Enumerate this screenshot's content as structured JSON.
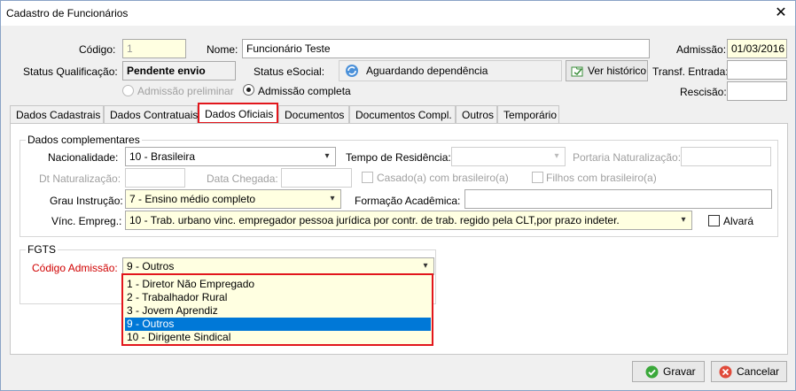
{
  "window": {
    "title": "Cadastro de Funcionários",
    "close_glyph": "✕"
  },
  "header": {
    "codigo_label": "Código:",
    "codigo_value": "1",
    "nome_label": "Nome:",
    "nome_value": "Funcionário Teste",
    "admissao_label": "Admissão:",
    "admissao_value": "01/03/2016",
    "status_qual_label": "Status Qualificação:",
    "status_qual_value": "Pendente envio",
    "status_esocial_label": "Status eSocial:",
    "status_esocial_value": "Aguardando dependência",
    "ver_historico_label": "Ver histórico",
    "transf_label": "Transf. Entrada:",
    "transf_value": "",
    "rescisao_label": "Rescisão:",
    "rescisao_value": "",
    "radio_preliminar": "Admissão preliminar",
    "radio_completa": "Admissão completa"
  },
  "tabs": [
    "Dados Cadastrais",
    "Dados Contratuais",
    "Dados Oficiais",
    "Documentos",
    "Documentos Compl.",
    "Outros",
    "Temporário"
  ],
  "dados_complementares": {
    "group_title": "Dados complementares",
    "nacionalidade_label": "Nacionalidade:",
    "nacionalidade_value": "10  -  Brasileira",
    "tempo_residencia_label": "Tempo de Residência:",
    "tempo_residencia_value": "",
    "portaria_label": "Portaria Naturalização:",
    "portaria_value": "",
    "dt_naturalizacao_label": "Dt Naturalização:",
    "dt_naturalizacao_value": "",
    "data_chegada_label": "Data Chegada:",
    "data_chegada_value": "",
    "casado_label": "Casado(a) com brasileiro(a)",
    "filhos_label": "Filhos com brasileiro(a)",
    "grau_instrucao_label": "Grau Instrução:",
    "grau_instrucao_value": "7  -  Ensino médio completo",
    "formacao_label": "Formação Acadêmica:",
    "formacao_value": "",
    "vinc_label": "Vínc. Empreg.:",
    "vinc_value": "10  -  Trab. urbano vinc.  empregador pessoa jurídica por contr. de trab. regido pela CLT,por prazo indeter.",
    "alvara_label": "Alvará"
  },
  "fgts": {
    "group_title": "FGTS",
    "codigo_admissao_label": "Código Admissão:",
    "codigo_admissao_value": "9 - Outros",
    "options": [
      "1 - Diretor Não Empregado",
      "2 - Trabalhador Rural",
      "3 - Jovem Aprendiz",
      "9 - Outros",
      "10 - Dirigente Sindical"
    ],
    "selected_index": 3
  },
  "footer": {
    "gravar_label": "Gravar",
    "cancelar_label": "Cancelar"
  },
  "colors": {
    "highlight_red": "#e2161c",
    "selection_blue": "#0078d7",
    "field_yellow": "#ffffe1"
  }
}
